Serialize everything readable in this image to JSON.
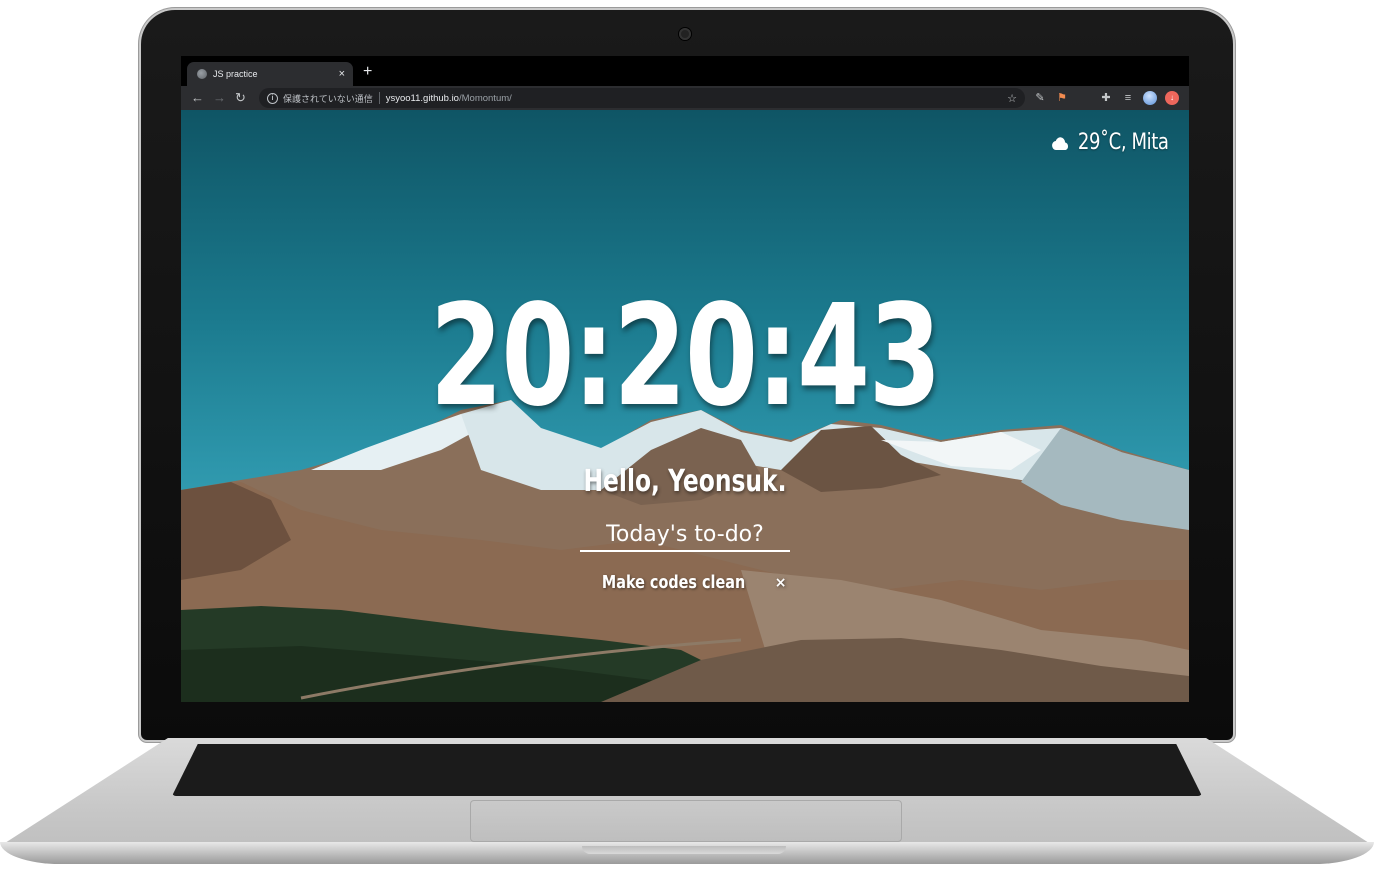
{
  "browser": {
    "tab_title": "JS practice",
    "tab_close": "×",
    "new_tab": "+",
    "nav": {
      "back": "←",
      "forward": "→",
      "reload": "↻"
    },
    "address": {
      "security_label": "保護されていない通信",
      "host": "ysyoo11.github.io",
      "path": "/Momontum/"
    }
  },
  "weather": {
    "icon": "cloud-icon",
    "text": "29˚C, Mita"
  },
  "clock": {
    "time": "20:20:43"
  },
  "greeting": {
    "text": "Hello, Yeonsuk."
  },
  "todo": {
    "placeholder": "Today's to-do?",
    "items": [
      {
        "text": "Make codes clean",
        "delete": "×"
      }
    ]
  }
}
